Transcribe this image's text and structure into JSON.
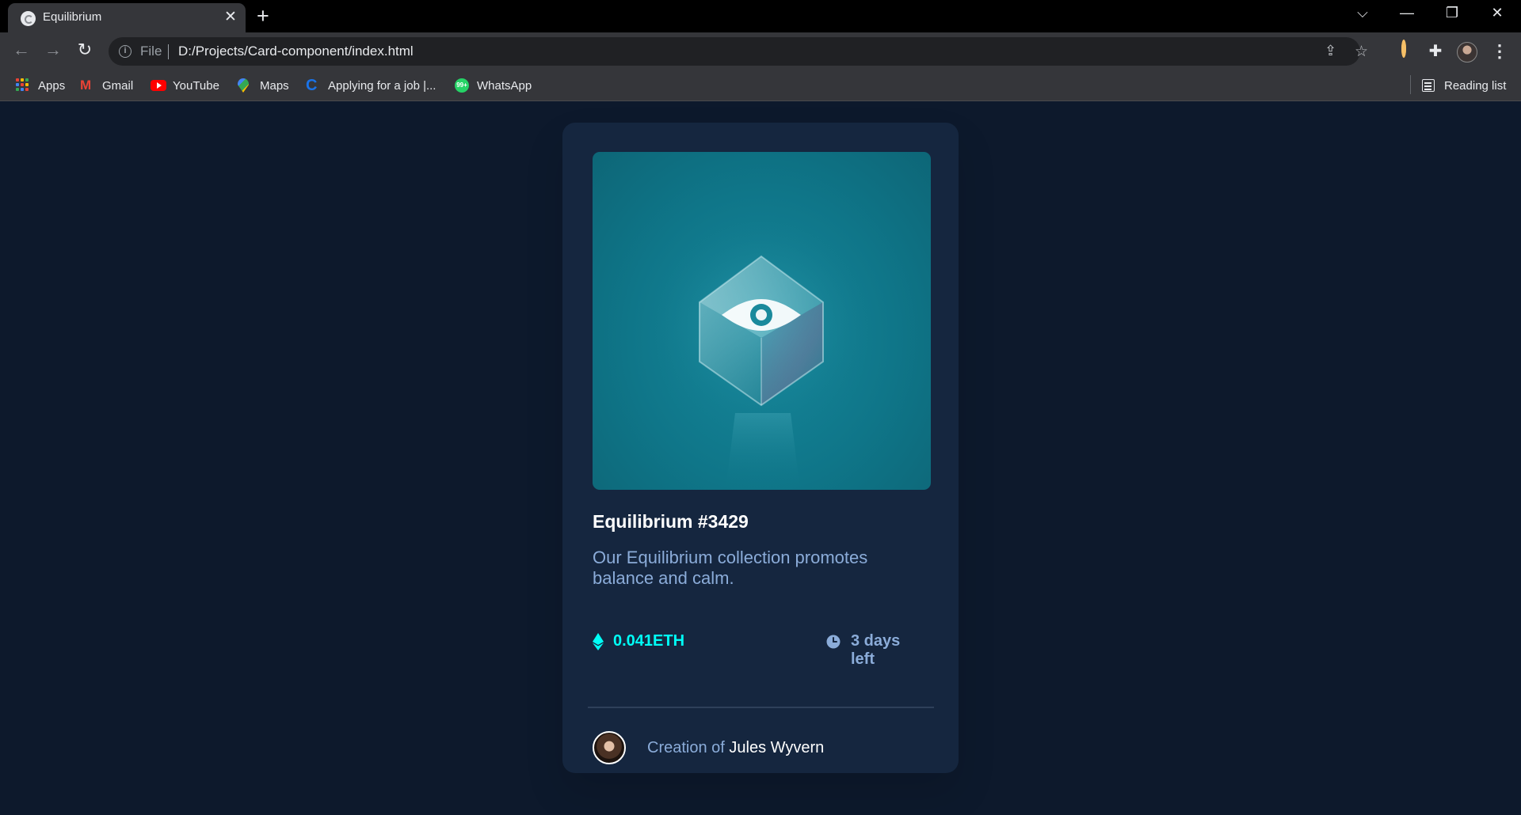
{
  "browser": {
    "tab": {
      "title": "Equilibrium"
    },
    "address": {
      "scheme": "File",
      "url": "D:/Projects/Card-component/index.html"
    },
    "bookmarks": [
      {
        "label": "Apps",
        "icon": "apps-icon"
      },
      {
        "label": "Gmail",
        "icon": "gmail-icon"
      },
      {
        "label": "YouTube",
        "icon": "youtube-icon"
      },
      {
        "label": "Maps",
        "icon": "maps-icon"
      },
      {
        "label": "Applying for a job |...",
        "icon": "c-icon"
      },
      {
        "label": "WhatsApp",
        "icon": "whatsapp-icon"
      }
    ],
    "reading_list": "Reading list",
    "whatsapp_badge": "99+"
  },
  "card": {
    "title": "Equilibrium #3429",
    "description": "Our Equilibrium collection promotes balance and calm.",
    "price": "0.041ETH",
    "time_left": "3 days left",
    "attribution_prefix": "Creation of ",
    "creator": "Jules Wyvern"
  },
  "colors": {
    "page_bg": "#0d192c",
    "card_bg": "#15263f",
    "cyan": "#00fff7",
    "soft_blue": "#8bacd9",
    "white": "#ffffff",
    "line": "#2e405a"
  }
}
